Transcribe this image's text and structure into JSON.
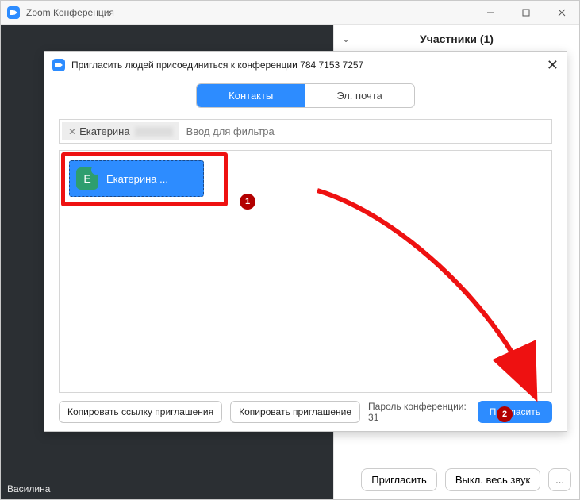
{
  "window": {
    "title": "Zoom Конференция"
  },
  "participants": {
    "title": "Участники (1)"
  },
  "video": {
    "name_overlay": "Василина"
  },
  "sidebar_footer": {
    "invite": "Пригласить",
    "mute_all": "Выкл. весь звук",
    "more": "..."
  },
  "dialog": {
    "title": "Пригласить людей присоединиться к конференции 784 7153 7257",
    "tabs": {
      "contacts": "Контакты",
      "email": "Эл. почта"
    },
    "filter": {
      "chip_name": "Екатерина",
      "placeholder": "Ввод для фильтра"
    },
    "contact": {
      "avatar_initial": "Е",
      "label": "Екатерина ..."
    },
    "footer": {
      "copy_link": "Копировать ссылку приглашения",
      "copy_invite": "Копировать приглашение",
      "password_label": "Пароль конференции: 31",
      "invite": "Пригласить"
    }
  },
  "annotations": {
    "one": "1",
    "two": "2"
  }
}
